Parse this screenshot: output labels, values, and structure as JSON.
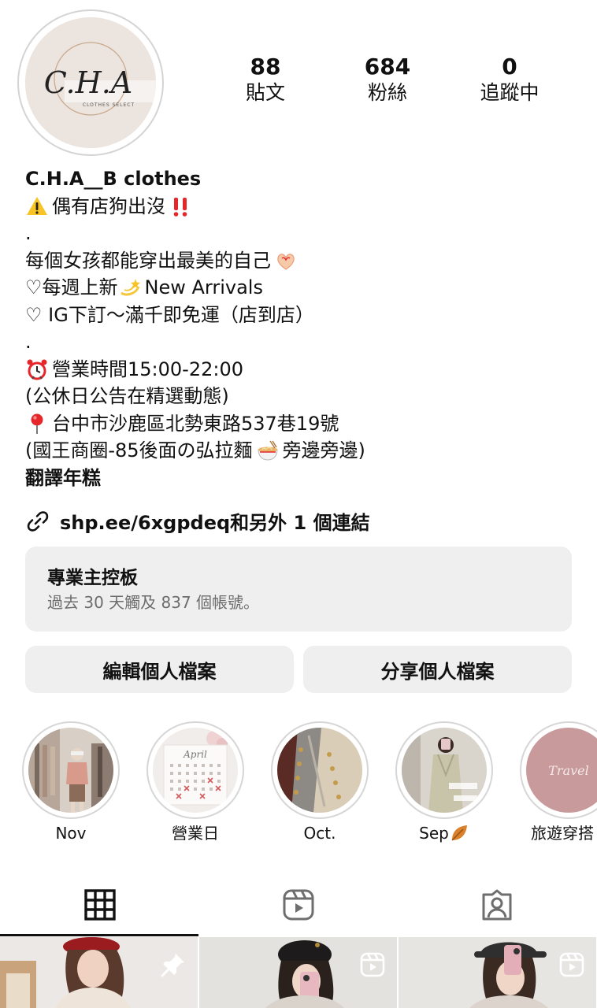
{
  "profile": {
    "logo_text": "C.H.A",
    "logo_subtext": "CLOTHES SELECT",
    "stats": [
      {
        "value": "88",
        "label": "貼文"
      },
      {
        "value": "684",
        "label": "粉絲"
      },
      {
        "value": "0",
        "label": "追蹤中"
      }
    ]
  },
  "bio": {
    "name": "C.H.A__B clothes",
    "line1": "偶有店狗出沒",
    "dot1": ".",
    "line2": "每個女孩都能穿出最美的自己",
    "line3a": "♡每週上新",
    "line3b": "New Arrivals",
    "line4": "♡ IG下訂～滿千即免運（店到店）",
    "dot2": ".",
    "line5": "營業時間15:00-22:00",
    "line6": "(公休日公告在精選動態)",
    "line7": "台中市沙鹿區北勢東路537巷19號",
    "line8a": "(國王商圈-85後面の弘拉麵",
    "line8b": "旁邊旁邊)",
    "translate": "翻譯年糕"
  },
  "link": {
    "text": "shp.ee/6xgpdeq和另外 1 個連結",
    "icon": "link-icon"
  },
  "dashboard": {
    "title": "專業主控板",
    "subtitle": "過去 30 天觸及 837 個帳號。"
  },
  "buttons": {
    "edit": "編輯個人檔案",
    "share": "分享個人檔案"
  },
  "highlights": [
    {
      "label": "Nov"
    },
    {
      "label": "營業日",
      "image_text": "April"
    },
    {
      "label": "Oct."
    },
    {
      "label": "Sep"
    },
    {
      "label": "旅遊穿搭",
      "image_text": "Travel"
    }
  ],
  "tabs": [
    {
      "icon": "grid-icon",
      "active": true
    },
    {
      "icon": "reels-icon",
      "active": false
    },
    {
      "icon": "tagged-icon",
      "active": false
    }
  ],
  "colors": {
    "button_bg": "#efefef",
    "muted_text": "#6d6d6d",
    "alarm_red": "#e5262b"
  }
}
